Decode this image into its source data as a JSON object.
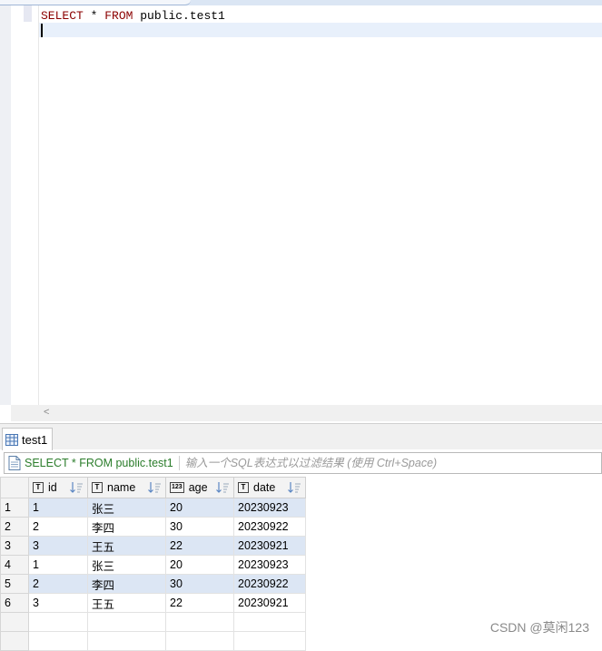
{
  "editor": {
    "sql_keyword1": "SELECT",
    "sql_star": " * ",
    "sql_keyword2": "FROM",
    "sql_table": " public.test1"
  },
  "result_tab": {
    "label": "test1",
    "icon": "table-grid-icon"
  },
  "filter": {
    "query_text": "SELECT * FROM public.test1",
    "placeholder": "输入一个SQL表达式以过滤结果 (使用 Ctrl+Space)"
  },
  "columns": [
    {
      "label": "id",
      "type_icon": "T"
    },
    {
      "label": "name",
      "type_icon": "T"
    },
    {
      "label": "age",
      "type_icon": "123"
    },
    {
      "label": "date",
      "type_icon": "T"
    }
  ],
  "rows": [
    {
      "num": "1",
      "id": "1",
      "name": "张三",
      "age": "20",
      "date": "20230923"
    },
    {
      "num": "2",
      "id": "2",
      "name": "李四",
      "age": "30",
      "date": "20230922"
    },
    {
      "num": "3",
      "id": "3",
      "name": "王五",
      "age": "22",
      "date": "20230921"
    },
    {
      "num": "4",
      "id": "1",
      "name": "张三",
      "age": "20",
      "date": "20230923"
    },
    {
      "num": "5",
      "id": "2",
      "name": "李四",
      "age": "30",
      "date": "20230922"
    },
    {
      "num": "6",
      "id": "3",
      "name": "王五",
      "age": "22",
      "date": "20230921"
    }
  ],
  "watermark": "CSDN @莫闲123",
  "colors": {
    "keyword": "#8b0000",
    "sql_green": "#2b7d2b",
    "row_highlight": "#dce6f4"
  }
}
